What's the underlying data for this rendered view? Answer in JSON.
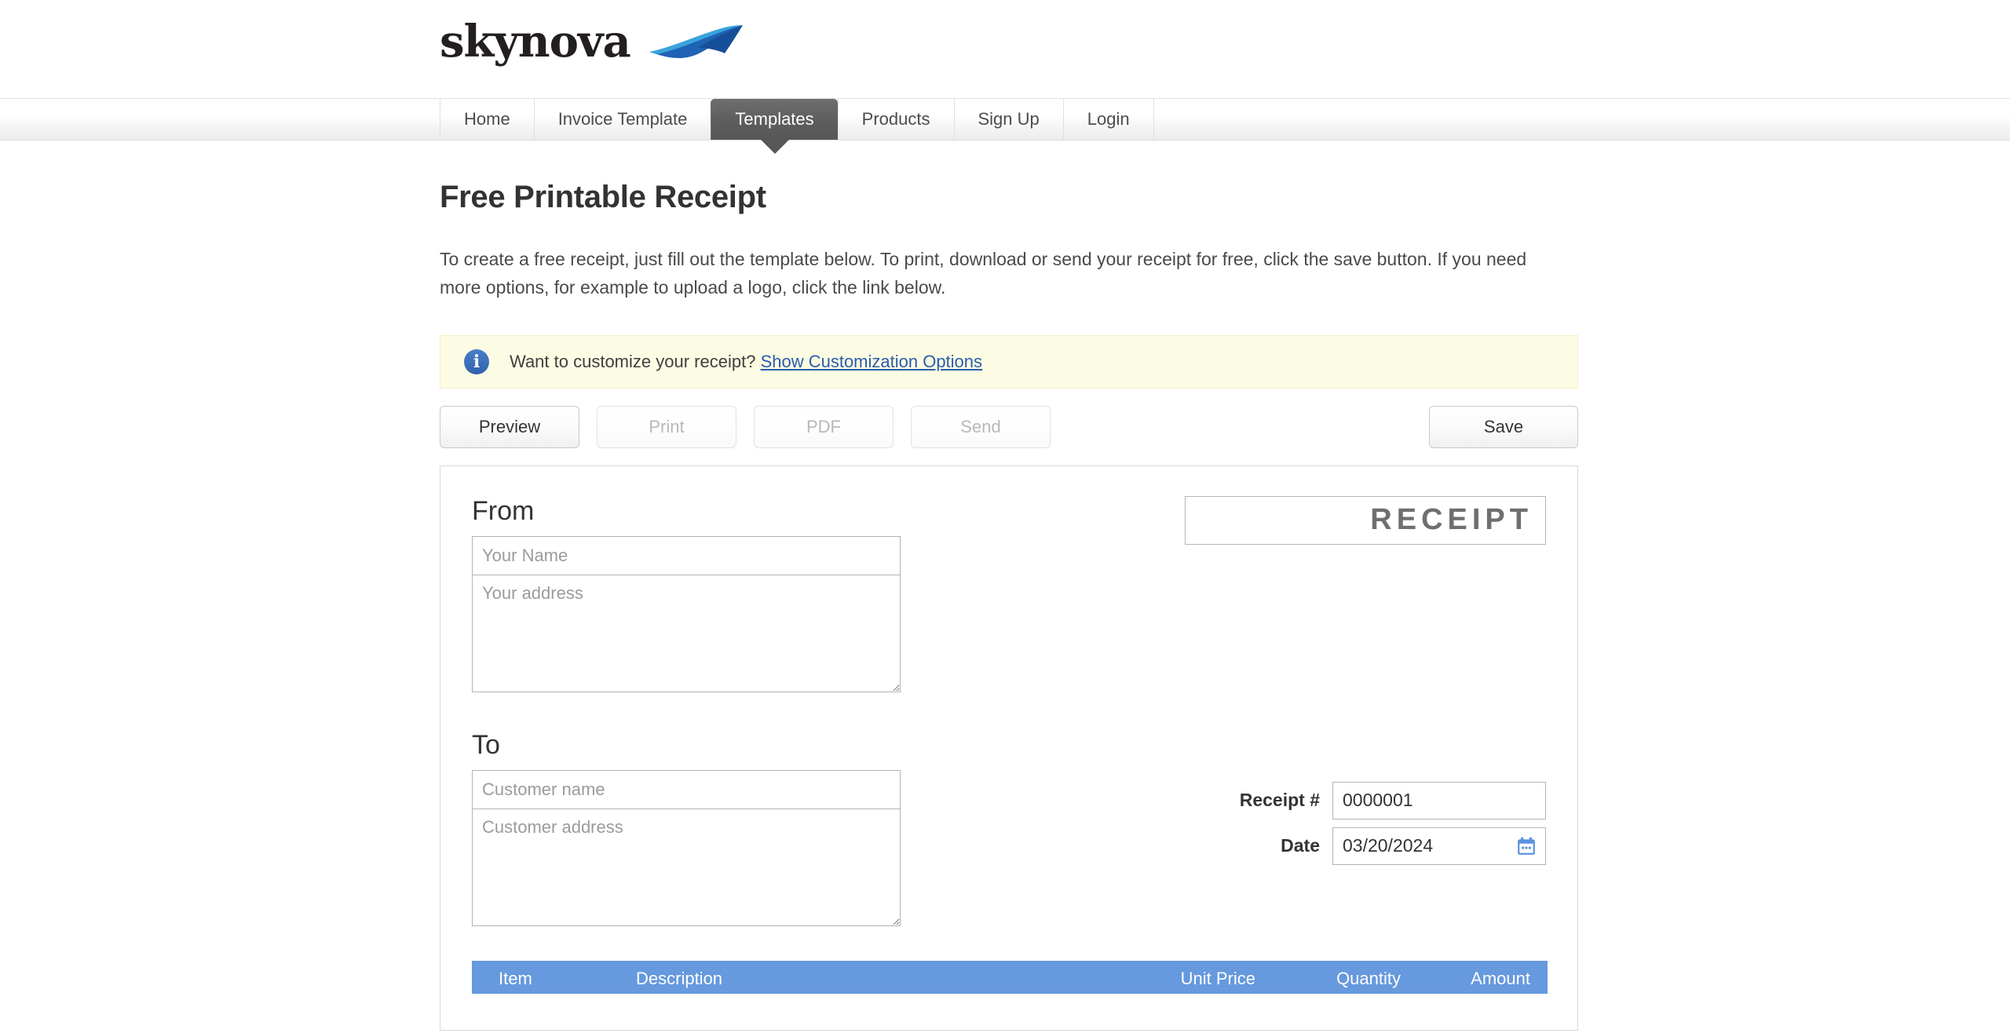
{
  "brand": {
    "name": "skynova",
    "swoosh_icon": "swoosh-icon"
  },
  "nav": {
    "items": [
      {
        "label": "Home",
        "active": false
      },
      {
        "label": "Invoice Template",
        "active": false
      },
      {
        "label": "Templates",
        "active": true
      },
      {
        "label": "Products",
        "active": false
      },
      {
        "label": "Sign Up",
        "active": false
      },
      {
        "label": "Login",
        "active": false
      }
    ]
  },
  "main": {
    "title": "Free Printable Receipt",
    "intro": "To create a free receipt, just fill out the template below. To print, download or send your receipt for free, click the save button. If you need more options, for example to upload a logo, click the link below."
  },
  "banner": {
    "icon": "info-icon",
    "text": "Want to customize your receipt?",
    "link_label": "Show Customization Options",
    "background_color": "#fcfbe3",
    "link_color": "#2a5db0"
  },
  "toolbar": {
    "preview_label": "Preview",
    "print_label": "Print",
    "pdf_label": "PDF",
    "send_label": "Send",
    "save_label": "Save"
  },
  "form": {
    "from": {
      "heading": "From",
      "name_placeholder": "Your Name",
      "name_value": "",
      "address_placeholder": "Your address",
      "address_value": ""
    },
    "to": {
      "heading": "To",
      "name_placeholder": "Customer name",
      "name_value": "",
      "address_placeholder": "Customer address",
      "address_value": ""
    },
    "document_title": "RECEIPT",
    "meta": {
      "receipt_number_label": "Receipt #",
      "receipt_number_value": "0000001",
      "date_label": "Date",
      "date_value": "03/20/2024",
      "date_picker_icon": "calendar-icon"
    }
  },
  "items_table": {
    "header_color": "#6699dd",
    "columns": [
      "Item",
      "Description",
      "Unit Price",
      "Quantity",
      "Amount"
    ],
    "rows": []
  }
}
